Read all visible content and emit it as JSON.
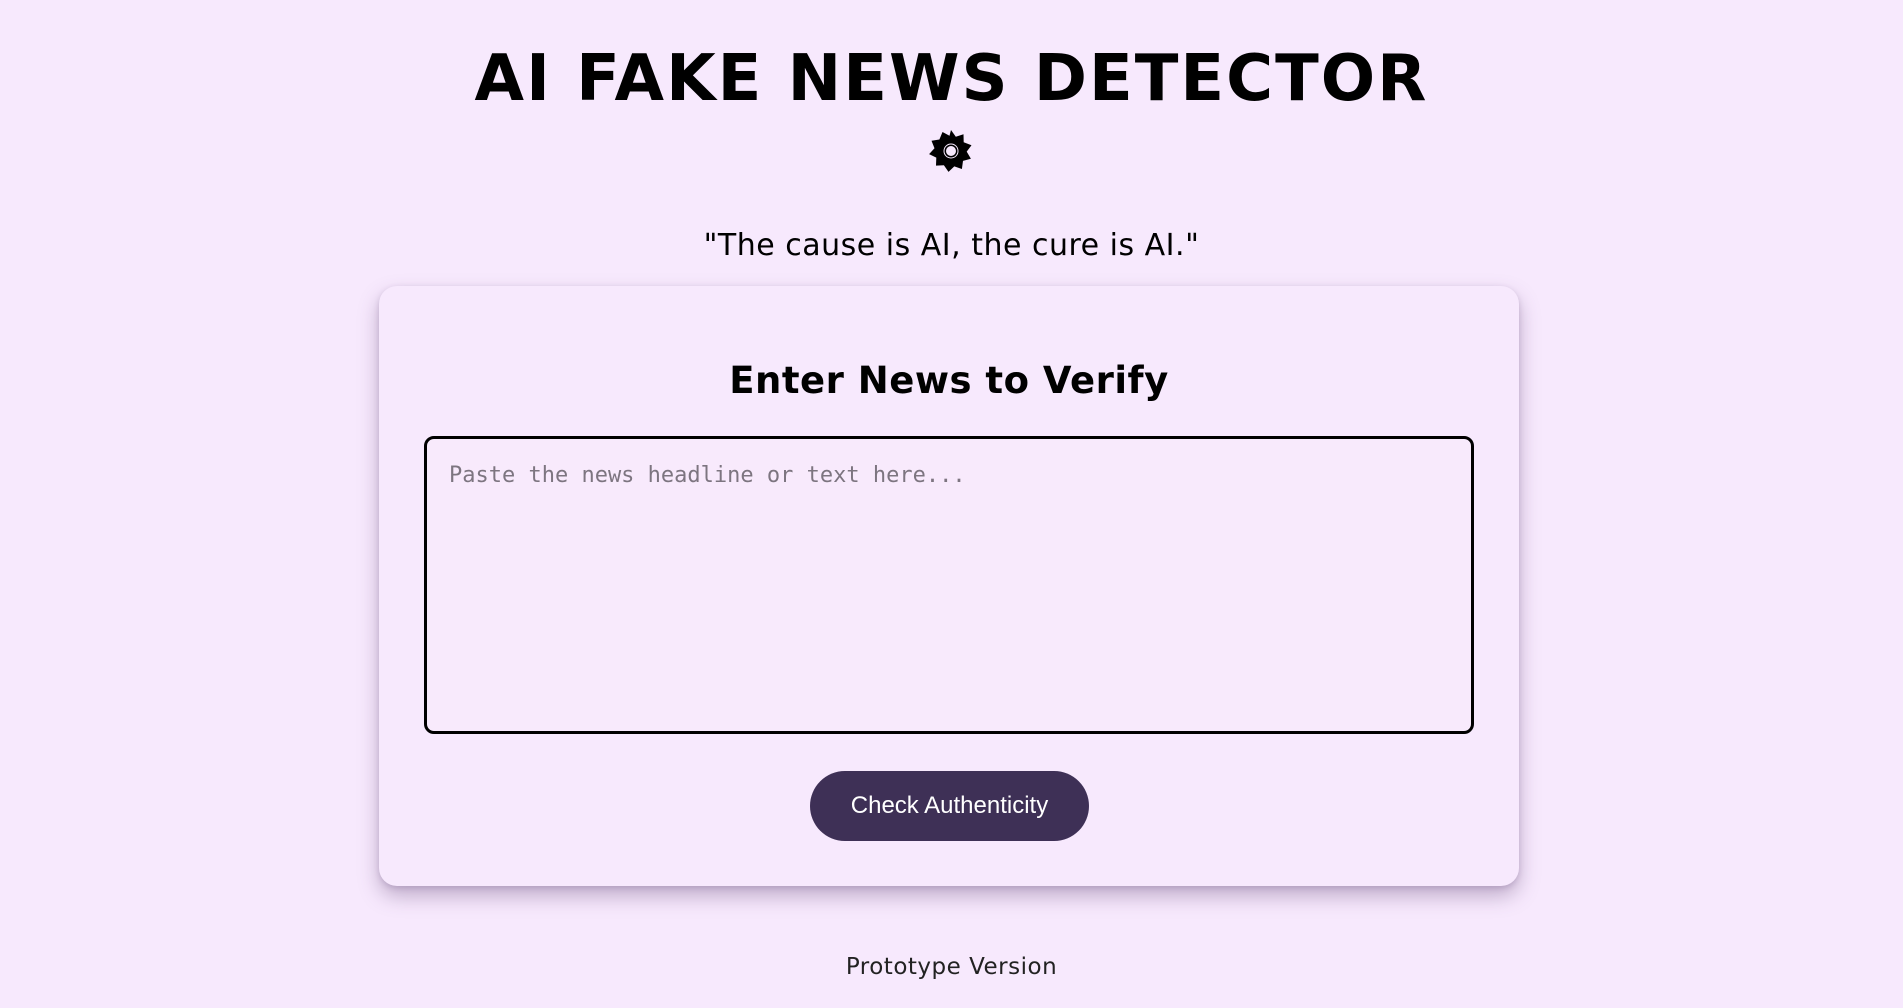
{
  "header": {
    "title": "AI FAKE NEWS DETECTOR",
    "icon": "gear-icon",
    "tagline": "\"The cause is AI, the cure is AI.\""
  },
  "card": {
    "heading": "Enter News to Verify",
    "input": {
      "placeholder": "Paste the news headline or text here...",
      "value": ""
    },
    "button_label": "Check Authenticity"
  },
  "footer": {
    "note": "Prototype Version"
  },
  "colors": {
    "background": "#f7e9fd",
    "button": "#3e3056",
    "button_text": "#ffffff",
    "text": "#000000"
  }
}
